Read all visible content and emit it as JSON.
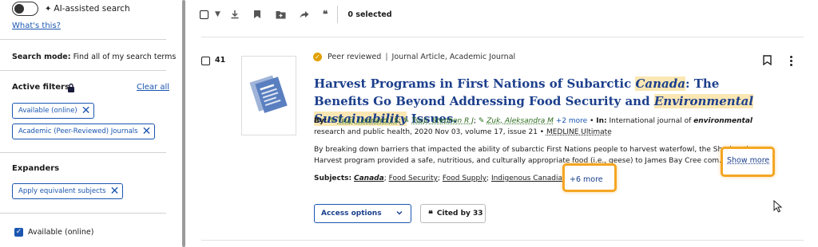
{
  "sidebar": {
    "ai_toggle_label": "AI-assisted search",
    "whats_this": "What's this?",
    "search_mode_label": "Search mode:",
    "search_mode_value": "Find all of my search terms",
    "active_filters_title": "Active filters",
    "clear_all": "Clear all",
    "filters": [
      "Available (online)",
      "Academic (Peer-Reviewed) Journals"
    ],
    "expanders_title": "Expanders",
    "expanders": [
      "Apply equivalent subjects"
    ],
    "checkbox_label": "Available (online)"
  },
  "toolbar": {
    "selected_count": "0 selected"
  },
  "result": {
    "number": "41",
    "peer_reviewed": "Peer reviewed",
    "type": "Journal Article, Academic Journal",
    "title_part1": "Harvest Programs in First Nations of Subarctic ",
    "title_hl1": "Canada",
    "title_part2": ": The Benefits Go Beyond Addressing Food Security and ",
    "title_hl2": "Environmental Sustainability",
    "title_part3": " Issues.",
    "by_label": "By:",
    "authors": [
      "Tsuji, Leonard J S",
      "Tsuji, Stephen R J",
      "Zuk, Aleksandra M"
    ],
    "authors_more": "+2 more",
    "in_label": "In:",
    "source_pre": "International journal of ",
    "source_em": "environmental",
    "source_post": " research and public health, 2020 Nov 03, volume 17, issue 21",
    "database": "MEDLINE Ultimate",
    "snippet": "By breaking down barriers that impacted the ability of subarctic First Nations people to harvest waterfowl, the Sharing-the-Harvest program provided a safe, nutritious, and culturally appropriate food (i.e., geese) to James Bay Cree com...",
    "show_more": "Show more",
    "subjects_label": "Subjects:",
    "subjects": [
      "Canada",
      "Food Security",
      "Food Supply",
      "Indigenous Canadians"
    ],
    "subjects_more": "+6 more",
    "access_options": "Access options",
    "cited_by": "Cited by 33"
  },
  "colors": {
    "link_blue": "#1a56b0",
    "title_blue": "#1c3f8c",
    "highlight": "#fbe7b3",
    "callout_orange": "#f5a623",
    "author_green": "#2b6a1c"
  }
}
